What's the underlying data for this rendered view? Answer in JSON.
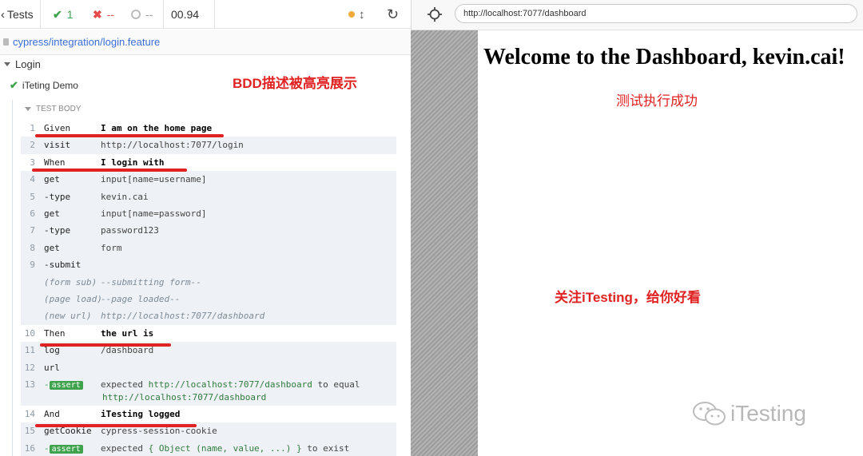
{
  "reporter": {
    "back_label": "Tests",
    "passed": "1",
    "failed": "--",
    "pending": "--",
    "duration": "00.94",
    "spec_path": "cypress/integration/login.feature",
    "suite": "Login",
    "test": "iTeting Demo",
    "test_body_label": "TEST BODY"
  },
  "commands": [
    {
      "num": "1",
      "name": "Given",
      "msg": "I am on the home page",
      "type": "bdd"
    },
    {
      "num": "2",
      "name": "visit",
      "msg": "http://localhost:7077/login",
      "type": "cmd"
    },
    {
      "num": "3",
      "name": "When",
      "msg": "I login with",
      "type": "bdd"
    },
    {
      "num": "4",
      "name": "get",
      "msg": "input[name=username]",
      "type": "cmd"
    },
    {
      "num": "5",
      "name": " -type",
      "msg": "kevin.cai",
      "type": "cmd"
    },
    {
      "num": "6",
      "name": "get",
      "msg": "input[name=password]",
      "type": "cmd"
    },
    {
      "num": "7",
      "name": " -type",
      "msg": "password123",
      "type": "cmd"
    },
    {
      "num": "8",
      "name": "get",
      "msg": "form",
      "type": "cmd"
    },
    {
      "num": "9",
      "name": " -submit",
      "msg": "",
      "type": "cmd"
    },
    {
      "num": "",
      "name": "(form sub)",
      "msg": "--submitting form--",
      "type": "ev"
    },
    {
      "num": "",
      "name": "(page load)",
      "msg": "--page loaded--",
      "type": "ev"
    },
    {
      "num": "",
      "name": "(new url)",
      "msg": "http://localhost:7077/dashboard",
      "type": "ev"
    },
    {
      "num": "10",
      "name": "Then",
      "msg": "the url is",
      "type": "bdd"
    },
    {
      "num": "11",
      "name": "log",
      "msg": "/dashboard",
      "type": "cmd"
    },
    {
      "num": "12",
      "name": "url",
      "msg": "",
      "type": "cmd"
    }
  ],
  "assert13": {
    "num": "13",
    "badge": "assert",
    "pre": "expected",
    "value": "http://localhost:7077/dashboard",
    "mid": "to equal",
    "value2": "http://localhost:7077/dashboard"
  },
  "commands_tail": [
    {
      "num": "14",
      "name": "And",
      "msg": "iTesting logged",
      "type": "bdd"
    },
    {
      "num": "15",
      "name": "getCookie",
      "msg": "cypress-session-cookie",
      "type": "cmd"
    }
  ],
  "assert16": {
    "num": "16",
    "badge": "assert",
    "pre": "expected",
    "value": "{ Object (name, value, ...) }",
    "mid": "to exist"
  },
  "browser": {
    "url": "http://localhost:7077/dashboard"
  },
  "app": {
    "heading": "Welcome to the Dashboard, kevin.cai!"
  },
  "annotations": {
    "bdd_note": "BDD描述被高亮展示",
    "success_note": "测试执行成功",
    "follow_note": "关注iTesting，给你好看"
  },
  "watermark": "iTesting",
  "colors": {
    "pass_green": "#3fa34d",
    "annotation_red": "#e02222",
    "link_blue": "#3b6ed6"
  }
}
